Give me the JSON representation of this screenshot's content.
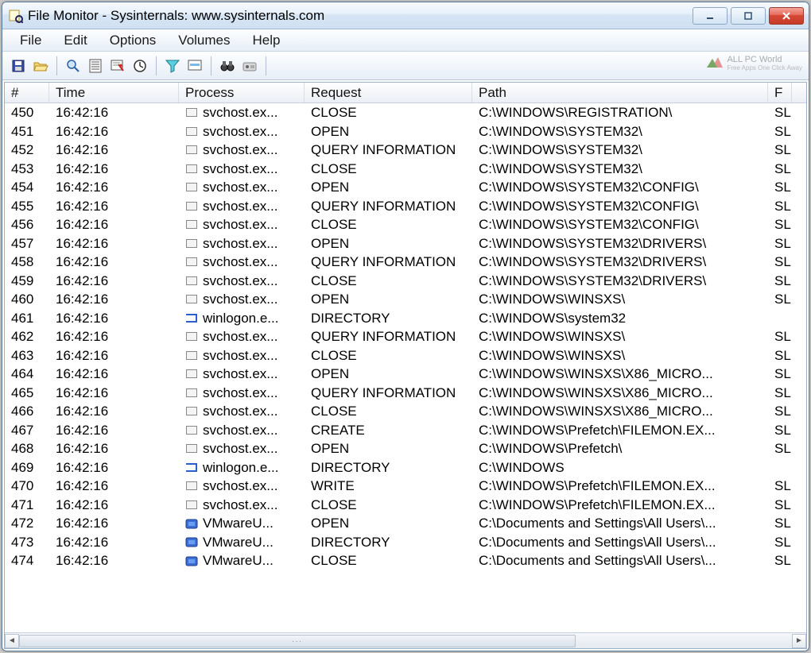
{
  "window": {
    "title": "File Monitor - Sysinternals: www.sysinternals.com"
  },
  "menubar": {
    "items": [
      "File",
      "Edit",
      "Options",
      "Volumes",
      "Help"
    ]
  },
  "toolbar": {
    "buttons": [
      {
        "name": "save-icon",
        "grp": 1
      },
      {
        "name": "open-icon",
        "grp": 1
      },
      {
        "name": "find-icon",
        "grp": 2
      },
      {
        "name": "autoscroll-icon",
        "grp": 2
      },
      {
        "name": "clear-icon",
        "grp": 2
      },
      {
        "name": "time-icon",
        "grp": 2
      },
      {
        "name": "filter-icon",
        "grp": 3
      },
      {
        "name": "highlight-icon",
        "grp": 3
      },
      {
        "name": "find-binoculars-icon",
        "grp": 4
      },
      {
        "name": "jump-icon",
        "grp": 4
      }
    ]
  },
  "watermark": {
    "title": "ALL PC World",
    "sub": "Free Apps One Click Away"
  },
  "columns": {
    "num": "#",
    "time": "Time",
    "process": "Process",
    "request": "Request",
    "path": "Path",
    "result": "F"
  },
  "rows": [
    {
      "n": "450",
      "t": "16:42:16",
      "p": "svchost.ex...",
      "pi": "box",
      "r": "CLOSE",
      "path": "C:\\WINDOWS\\REGISTRATION\\",
      "res": "SL"
    },
    {
      "n": "451",
      "t": "16:42:16",
      "p": "svchost.ex...",
      "pi": "box",
      "r": "OPEN",
      "path": "C:\\WINDOWS\\SYSTEM32\\",
      "res": "SL"
    },
    {
      "n": "452",
      "t": "16:42:16",
      "p": "svchost.ex...",
      "pi": "box",
      "r": "QUERY INFORMATION",
      "path": "C:\\WINDOWS\\SYSTEM32\\",
      "res": "SL"
    },
    {
      "n": "453",
      "t": "16:42:16",
      "p": "svchost.ex...",
      "pi": "box",
      "r": "CLOSE",
      "path": "C:\\WINDOWS\\SYSTEM32\\",
      "res": "SL"
    },
    {
      "n": "454",
      "t": "16:42:16",
      "p": "svchost.ex...",
      "pi": "box",
      "r": "OPEN",
      "path": "C:\\WINDOWS\\SYSTEM32\\CONFIG\\",
      "res": "SL"
    },
    {
      "n": "455",
      "t": "16:42:16",
      "p": "svchost.ex...",
      "pi": "box",
      "r": "QUERY INFORMATION",
      "path": "C:\\WINDOWS\\SYSTEM32\\CONFIG\\",
      "res": "SL"
    },
    {
      "n": "456",
      "t": "16:42:16",
      "p": "svchost.ex...",
      "pi": "box",
      "r": "CLOSE",
      "path": "C:\\WINDOWS\\SYSTEM32\\CONFIG\\",
      "res": "SL"
    },
    {
      "n": "457",
      "t": "16:42:16",
      "p": "svchost.ex...",
      "pi": "box",
      "r": "OPEN",
      "path": "C:\\WINDOWS\\SYSTEM32\\DRIVERS\\",
      "res": "SL"
    },
    {
      "n": "458",
      "t": "16:42:16",
      "p": "svchost.ex...",
      "pi": "box",
      "r": "QUERY INFORMATION",
      "path": "C:\\WINDOWS\\SYSTEM32\\DRIVERS\\",
      "res": "SL"
    },
    {
      "n": "459",
      "t": "16:42:16",
      "p": "svchost.ex...",
      "pi": "box",
      "r": "CLOSE",
      "path": "C:\\WINDOWS\\SYSTEM32\\DRIVERS\\",
      "res": "SL"
    },
    {
      "n": "460",
      "t": "16:42:16",
      "p": "svchost.ex...",
      "pi": "box",
      "r": "OPEN",
      "path": "C:\\WINDOWS\\WINSXS\\",
      "res": "SL"
    },
    {
      "n": "461",
      "t": "16:42:16",
      "p": "winlogon.e...",
      "pi": "blue",
      "r": "DIRECTORY",
      "path": "C:\\WINDOWS\\system32",
      "res": ""
    },
    {
      "n": "462",
      "t": "16:42:16",
      "p": "svchost.ex...",
      "pi": "box",
      "r": "QUERY INFORMATION",
      "path": "C:\\WINDOWS\\WINSXS\\",
      "res": "SL"
    },
    {
      "n": "463",
      "t": "16:42:16",
      "p": "svchost.ex...",
      "pi": "box",
      "r": "CLOSE",
      "path": "C:\\WINDOWS\\WINSXS\\",
      "res": "SL"
    },
    {
      "n": "464",
      "t": "16:42:16",
      "p": "svchost.ex...",
      "pi": "box",
      "r": "OPEN",
      "path": "C:\\WINDOWS\\WINSXS\\X86_MICRO...",
      "res": "SL"
    },
    {
      "n": "465",
      "t": "16:42:16",
      "p": "svchost.ex...",
      "pi": "box",
      "r": "QUERY INFORMATION",
      "path": "C:\\WINDOWS\\WINSXS\\X86_MICRO...",
      "res": "SL"
    },
    {
      "n": "466",
      "t": "16:42:16",
      "p": "svchost.ex...",
      "pi": "box",
      "r": "CLOSE",
      "path": "C:\\WINDOWS\\WINSXS\\X86_MICRO...",
      "res": "SL"
    },
    {
      "n": "467",
      "t": "16:42:16",
      "p": "svchost.ex...",
      "pi": "box",
      "r": "CREATE",
      "path": "C:\\WINDOWS\\Prefetch\\FILEMON.EX...",
      "res": "SL"
    },
    {
      "n": "468",
      "t": "16:42:16",
      "p": "svchost.ex...",
      "pi": "box",
      "r": "OPEN",
      "path": "C:\\WINDOWS\\Prefetch\\",
      "res": "SL"
    },
    {
      "n": "469",
      "t": "16:42:16",
      "p": "winlogon.e...",
      "pi": "blue",
      "r": "DIRECTORY",
      "path": "C:\\WINDOWS",
      "res": ""
    },
    {
      "n": "470",
      "t": "16:42:16",
      "p": "svchost.ex...",
      "pi": "box",
      "r": "WRITE",
      "path": "C:\\WINDOWS\\Prefetch\\FILEMON.EX...",
      "res": "SL"
    },
    {
      "n": "471",
      "t": "16:42:16",
      "p": "svchost.ex...",
      "pi": "box",
      "r": "CLOSE",
      "path": "C:\\WINDOWS\\Prefetch\\FILEMON.EX...",
      "res": "SL"
    },
    {
      "n": "472",
      "t": "16:42:16",
      "p": "VMwareU...",
      "pi": "vm",
      "r": "OPEN",
      "path": "C:\\Documents and Settings\\All Users\\...",
      "res": "SL"
    },
    {
      "n": "473",
      "t": "16:42:16",
      "p": "VMwareU...",
      "pi": "vm",
      "r": "DIRECTORY",
      "path": "C:\\Documents and Settings\\All Users\\...",
      "res": "SL"
    },
    {
      "n": "474",
      "t": "16:42:16",
      "p": "VMwareU...",
      "pi": "vm",
      "r": "CLOSE",
      "path": "C:\\Documents and Settings\\All Users\\...",
      "res": "SL"
    }
  ]
}
